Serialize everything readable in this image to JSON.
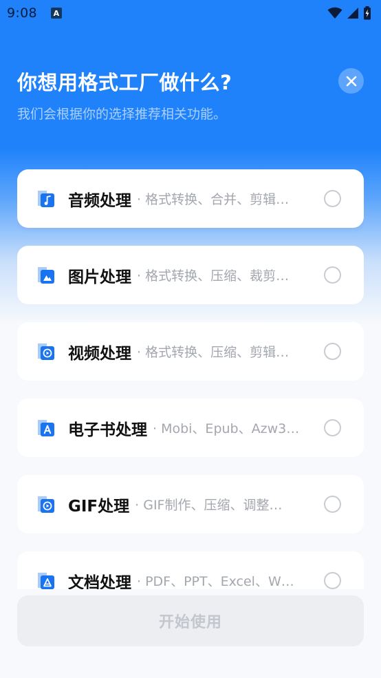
{
  "status_bar": {
    "time": "9:08",
    "app_icon_letter": "A",
    "icons": [
      "wifi-icon",
      "signal-icon",
      "battery-icon"
    ]
  },
  "header": {
    "title": "你想用格式工厂做什么?",
    "subtitle": "我们会根据你的选择推荐相关功能。",
    "close_icon": "close-icon"
  },
  "options": [
    {
      "title": "音频处理",
      "desc": "· 格式转换、合并、剪辑…",
      "icon": "audio-icon",
      "selected": true
    },
    {
      "title": "图片处理",
      "desc": "· 格式转换、压缩、裁剪…",
      "icon": "image-icon",
      "selected": false
    },
    {
      "title": "视频处理",
      "desc": "· 格式转换、压缩、剪辑…",
      "icon": "video-icon",
      "selected": false
    },
    {
      "title": "电子书处理",
      "desc": "· Mobi、Epub、Azw3…",
      "icon": "ebook-icon",
      "selected": false
    },
    {
      "title": "GIF处理",
      "desc": "· GIF制作、压缩、调整…",
      "icon": "gif-icon",
      "selected": false
    },
    {
      "title": "文档处理",
      "desc": "· PDF、PPT、Excel、W…",
      "icon": "document-icon",
      "selected": false
    }
  ],
  "start_button": {
    "label": "开始使用"
  },
  "colors": {
    "primary": "#1f82fb",
    "icon_accent": "#1a74f0",
    "icon_light": "#a9ccfb",
    "button_disabled_bg": "#eceef2",
    "button_disabled_text": "#c3c6cc"
  }
}
